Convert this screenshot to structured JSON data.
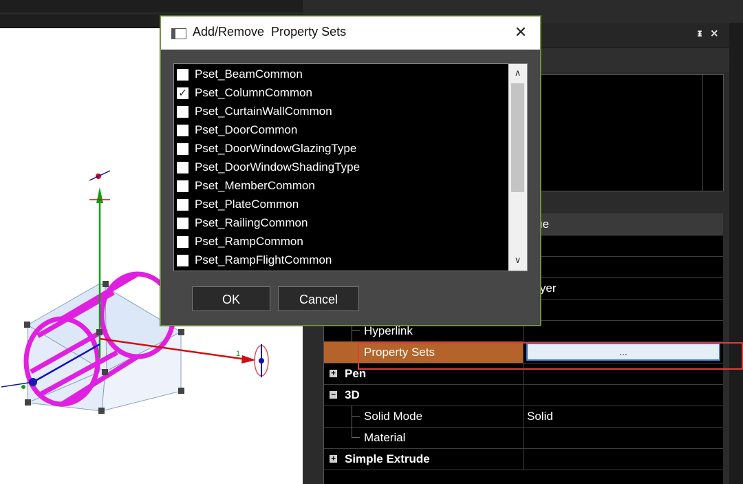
{
  "panel": {
    "pin_icon": "pin-icon",
    "pin_symbol": "ᵻ",
    "close_symbol": "×",
    "grid": {
      "value_header": "alue",
      "rows": [
        {
          "name": "",
          "value": ""
        },
        {
          "name": "",
          "value": ""
        },
        {
          "name": "",
          "value": "Layer"
        },
        {
          "name": "",
          "value": ""
        },
        {
          "name": "Hyperlink",
          "value": ""
        },
        {
          "name": "Property Sets",
          "value": "..."
        },
        {
          "name": "Pen",
          "value": ""
        },
        {
          "name": "3D",
          "value": ""
        },
        {
          "name": "Solid Mode",
          "value": "Solid"
        },
        {
          "name": "Material",
          "value": ""
        },
        {
          "name": "Simple Extrude",
          "value": ""
        }
      ],
      "pen_expander": "+",
      "threed_expander": "−",
      "extrude_expander": "+"
    }
  },
  "dialog": {
    "title": "Add/Remove  Property Sets",
    "close_symbol": "✕",
    "items": [
      {
        "label": "Pset_BeamCommon",
        "checked": false
      },
      {
        "label": "Pset_ColumnCommon",
        "checked": true
      },
      {
        "label": "Pset_CurtainWallCommon",
        "checked": false
      },
      {
        "label": "Pset_DoorCommon",
        "checked": false
      },
      {
        "label": "Pset_DoorWindowGlazingType",
        "checked": false
      },
      {
        "label": "Pset_DoorWindowShadingType",
        "checked": false
      },
      {
        "label": "Pset_MemberCommon",
        "checked": false
      },
      {
        "label": "Pset_PlateCommon",
        "checked": false
      },
      {
        "label": "Pset_RailingCommon",
        "checked": false
      },
      {
        "label": "Pset_RampCommon",
        "checked": false
      },
      {
        "label": "Pset_RampFlightCommon",
        "checked": false
      }
    ],
    "check_mark": "✓",
    "scroll_up": "∧",
    "scroll_down": "∨",
    "ok_label": "OK",
    "cancel_label": "Cancel"
  },
  "scene": {
    "axis_label_x": "1",
    "colors": {
      "magenta": "#e020e0",
      "axis_x": "#d01010",
      "axis_y": "#10a010",
      "axis_z": "#1010c0",
      "box_face": "#dce8f8"
    }
  }
}
